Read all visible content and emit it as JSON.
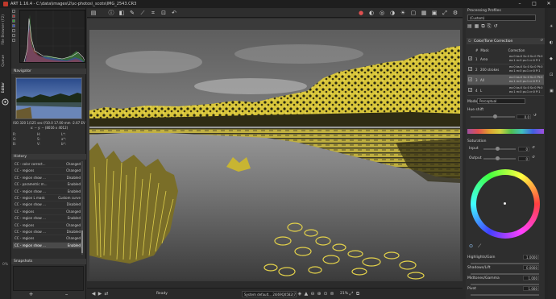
{
  "window": {
    "title": "ART 1.16.4 - C:\\data\\images\\2\\sc-photos\\_scots\\IMG_2543.CR3",
    "controls": [
      "–",
      "□",
      "✕"
    ]
  },
  "left_tabs": [
    "File Browser (F2)",
    "Queue",
    "Editor"
  ],
  "histogram": {
    "label": "histogram"
  },
  "navigator": {
    "header": "Navigator",
    "exif": "ISO 320    1/125 sec    f/10.0    17.00 mm    -2.67 EV",
    "coords": "x: --   y: --   (8016 x 4012)",
    "grid": [
      [
        "R:",
        "H:",
        "L*:"
      ],
      [
        "G:",
        "S:",
        "a*:"
      ],
      [
        "B:",
        "V:",
        "b*:"
      ]
    ]
  },
  "history": {
    "header": "History",
    "rows": [
      {
        "name": "CC - color correct...",
        "status": "Changed"
      },
      {
        "name": "CC - regions",
        "status": "Changed"
      },
      {
        "name": "CC - region show ...",
        "status": "Disabled"
      },
      {
        "name": "CC - parametric m...",
        "status": "Enabled"
      },
      {
        "name": "CC - region show ...",
        "status": "Enabled"
      },
      {
        "name": "CC - region L mask",
        "status": "Custom curve"
      },
      {
        "name": "CC - region show ...",
        "status": "Disabled"
      },
      {
        "name": "CC - regions",
        "status": "Changed"
      },
      {
        "name": "CC - region show ...",
        "status": "Enabled"
      },
      {
        "name": "CC - regions",
        "status": "Changed"
      },
      {
        "name": "CC - region show ...",
        "status": "Disabled"
      },
      {
        "name": "CC - regions",
        "status": "Changed"
      },
      {
        "name": "CC - region show ...",
        "status": "Enabled"
      }
    ],
    "selected_index": 12
  },
  "snapshots": {
    "header": "Snapshots",
    "add": "+",
    "remove": "–"
  },
  "left_zoom_label": "0%",
  "toolbar": {
    "icons": [
      "folder-icon",
      "info-icon",
      "before-after-icon",
      "eyedropper-icon",
      "straighten-icon",
      "crop-icon",
      "transform-icon",
      "undo-icon"
    ],
    "right_icons": [
      "red-channel-icon",
      "green-channel-icon",
      "blue-channel-icon",
      "luminance-icon",
      "focus-mask-icon",
      "shadows-clip-icon",
      "highlights-clip-icon",
      "settings-icon"
    ]
  },
  "status": {
    "ready": "Ready",
    "profile": "System default... 24i69Q0582(7)",
    "zoom": "21%",
    "zoom_icons": [
      "zoom-out-icon",
      "zoom-in-icon",
      "zoom-fit-icon",
      "zoom-100-icon",
      "zoom-fill-icon",
      "new-window-icon"
    ]
  },
  "processing_profiles": {
    "header": "Processing Profiles",
    "value": "(Custom)"
  },
  "color_tone": {
    "header": "Color/Tone Correction",
    "col_mask": "Mask",
    "col_correction": "Correction",
    "masks": [
      {
        "num": "1",
        "name": "Area",
        "checked": true,
        "corr": "ex:0 bs:0 Sc:0 Sc:0 Pt:0\nex:1 m:0 ps:1 cr:0 P:1"
      },
      {
        "num": "2",
        "name": "200 strokes",
        "checked": true,
        "corr": "ex:0 bs:0 Sc:0 Sc:0 Pt:0\nex:1 m:0 ps:1 cr:0 P:1"
      },
      {
        "num": "3",
        "name": "All",
        "checked": true,
        "corr": "ex:0 bs:0 Sc:0 Sc:0 Pt:0\nex:1 m:0 ps:1 cr:0 P:1"
      },
      {
        "num": "4",
        "name": "L",
        "checked": true,
        "corr": "ex:0 bs:0 Sc:0 Sc:0 Pt:0\nex:1 m:0 ps:1 cr:0 P:1"
      }
    ],
    "selected_index": 2,
    "mode_label": "Mode:",
    "mode_value": "Perceptual",
    "hue_shift_label": "Hue shift",
    "hue_shift_value": "0.0",
    "saturation_label": "Saturation",
    "input_label": "Input",
    "input_value": "0",
    "output_label": "Output",
    "output_value": "0",
    "sliders": [
      {
        "label": "Highlights/Gain",
        "value": "1.0000"
      },
      {
        "label": "Shadows/Lift",
        "value": "0.0000"
      },
      {
        "label": "Midtones/Gamma",
        "value": "1.000"
      },
      {
        "label": "Pivot",
        "value": "1.000"
      }
    ]
  }
}
